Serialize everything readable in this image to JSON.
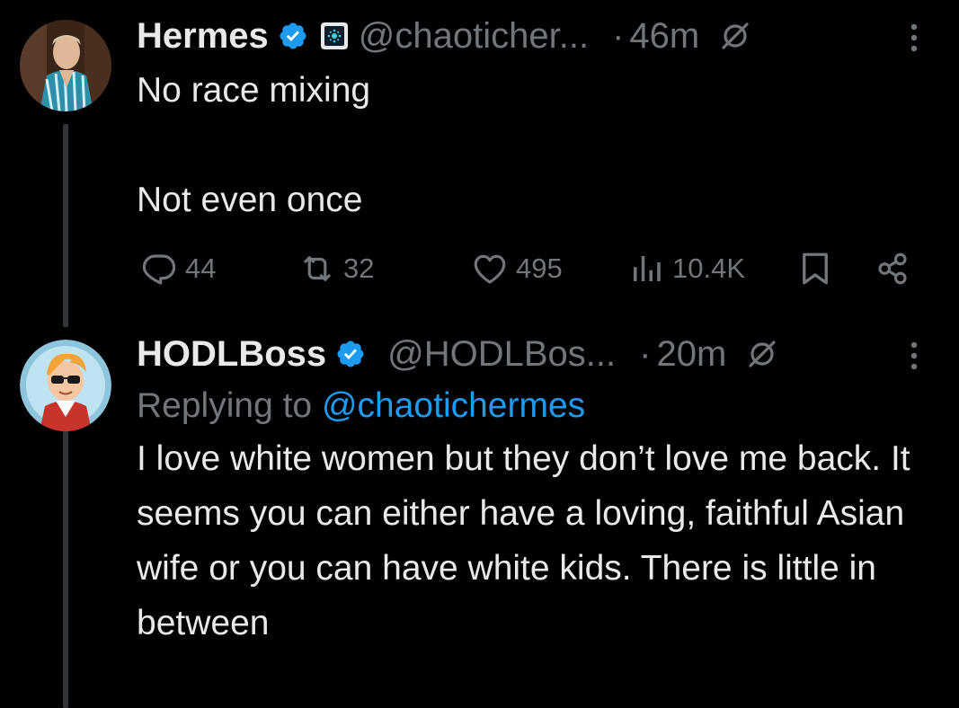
{
  "colors": {
    "background": "#000000",
    "text_primary": "#e7e9ea",
    "text_secondary": "#71767b",
    "verified_blue": "#1d9bf0",
    "mention_blue": "#1d9bf0",
    "thread_line": "#333639"
  },
  "tweets": [
    {
      "display_name": "Hermes",
      "handle": "@chaoticher...",
      "dot": "·",
      "time": "46m",
      "text": "No race mixing\n\nNot even once",
      "verified": true,
      "affiliate_badge": true,
      "avatar_icon": "user-avatar-photo",
      "actions": {
        "replies": "44",
        "retweets": "32",
        "likes": "495",
        "views": "10.4K"
      }
    },
    {
      "display_name": "HODLBoss",
      "handle": "@HODLBos...",
      "dot": "·",
      "time": "20m",
      "reply_prefix": "Replying to ",
      "reply_mention": "@chaotichermes",
      "text": "I love white women but they don’t love me back. It seems you can either have a loving, faithful Asian wife or you can have white kids. There is little in between",
      "verified": true,
      "avatar_icon": "cartoon-avatar"
    }
  ]
}
